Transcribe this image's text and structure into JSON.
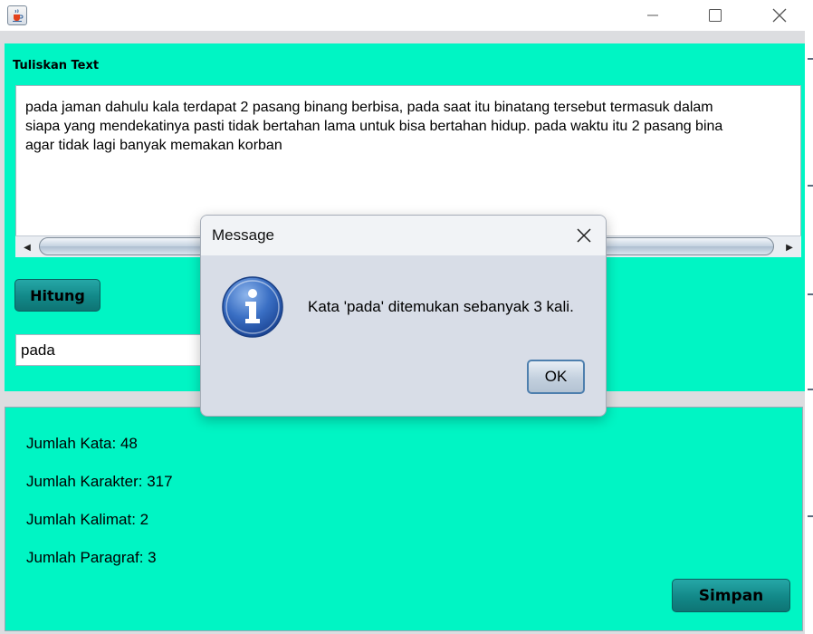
{
  "window": {
    "icon": "java-cup-icon",
    "controls": {
      "minimize": "minimize-icon",
      "maximize": "maximize-icon",
      "close": "close-icon"
    }
  },
  "input_panel": {
    "title": "Tuliskan Text",
    "text_lines": [
      "pada jaman dahulu kala terdapat 2 pasang binang berbisa, pada saat itu binatang tersebut termasuk dalam",
      "siapa yang mendekatinya pasti tidak bertahan lama untuk bisa bertahan hidup. pada waktu itu 2 pasang bina",
      "agar tidak lagi banyak memakan korban"
    ],
    "hitung_label": "Hitung",
    "search_value": "pada"
  },
  "result_panel": {
    "jumlah_kata": "Jumlah Kata: 48",
    "jumlah_karakter": "Jumlah Karakter: 317",
    "jumlah_kalimat": "Jumlah Kalimat: 2",
    "jumlah_paragraf": "Jumlah Paragraf: 3",
    "simpan_label": "Simpan"
  },
  "dialog": {
    "title": "Message",
    "message": "Kata 'pada' ditemukan sebanyak 3 kali.",
    "ok_label": "OK",
    "icon": "info-icon"
  },
  "colors": {
    "panel_bg": "#00f5c4",
    "button_teal": "#128888",
    "dialog_bg": "#d8dde7"
  }
}
